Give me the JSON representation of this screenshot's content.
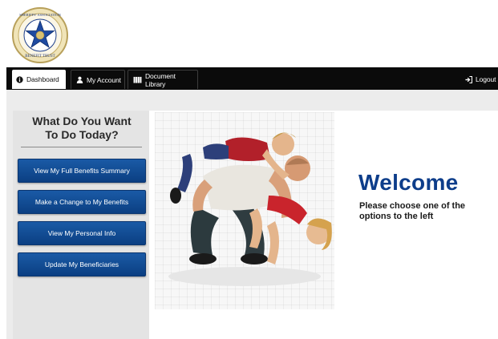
{
  "logo": {
    "alt": "Riverside Sheriffs' Association Benefit Trust"
  },
  "nav": {
    "tabs": [
      {
        "label": "Dashboard",
        "icon": "info-circle-icon"
      },
      {
        "label": "My Account",
        "icon": "user-icon"
      },
      {
        "label": "Document Library",
        "icon": "book-icon"
      }
    ],
    "logout_label": "Logout",
    "logout_icon": "logout-icon"
  },
  "sidebar": {
    "title_line1": "What Do You Want",
    "title_line2": "To Do Today?",
    "buttons": [
      "View My Full Benefits Summary",
      "Make a Change to My Benefits",
      "View My Personal Info",
      "Update My Beneficiaries"
    ]
  },
  "main": {
    "welcome_title": "Welcome",
    "welcome_text": "Please choose one of the options to the left"
  },
  "colors": {
    "navbar": "#0b0b0b",
    "button_blue": "#0b3f82",
    "welcome_blue": "#0d3d8a",
    "sidebar_bg": "#e4e4e4"
  }
}
